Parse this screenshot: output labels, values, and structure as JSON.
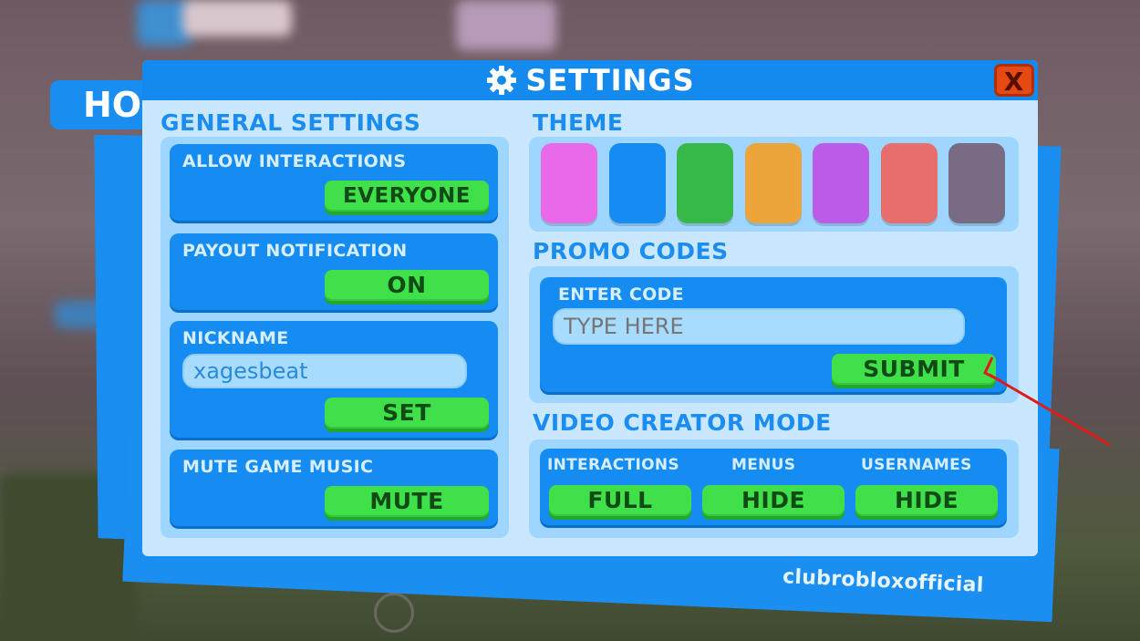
{
  "background": {
    "hud_tab_label": "HO"
  },
  "window": {
    "title": "SETTINGS",
    "title_icon": "gear-icon",
    "close_label": "X"
  },
  "general": {
    "heading": "GENERAL SETTINGS",
    "allow_interactions": {
      "label": "ALLOW INTERACTIONS",
      "button": "EVERYONE"
    },
    "payout_notification": {
      "label": "PAYOUT NOTIFICATION",
      "button": "ON"
    },
    "nickname": {
      "label": "NICKNAME",
      "value": "xagesbeat",
      "button": "SET"
    },
    "mute_music": {
      "label": "MUTE GAME MUSIC",
      "button": "MUTE"
    }
  },
  "theme": {
    "heading": "THEME",
    "swatches": [
      "#e86ae8",
      "#148cf1",
      "#37b94a",
      "#eba53a",
      "#bb5be8",
      "#e86e6e",
      "#786c85"
    ]
  },
  "promo": {
    "heading": "PROMO CODES",
    "label": "ENTER CODE",
    "placeholder": "TYPE HERE",
    "button": "SUBMIT"
  },
  "video_creator": {
    "heading": "VIDEO CREATOR MODE",
    "options": [
      {
        "label": "INTERACTIONS",
        "button": "FULL"
      },
      {
        "label": "MENUS",
        "button": "HIDE"
      },
      {
        "label": "USERNAMES",
        "button": "HIDE"
      }
    ]
  },
  "watermark": "clubrobloxofficial",
  "colors": {
    "accent": "#1489ee",
    "panel": "#c9e8ff",
    "button_green": "#3fe04a",
    "close_red": "#e54a15",
    "arrow_red": "#e01b1b"
  }
}
